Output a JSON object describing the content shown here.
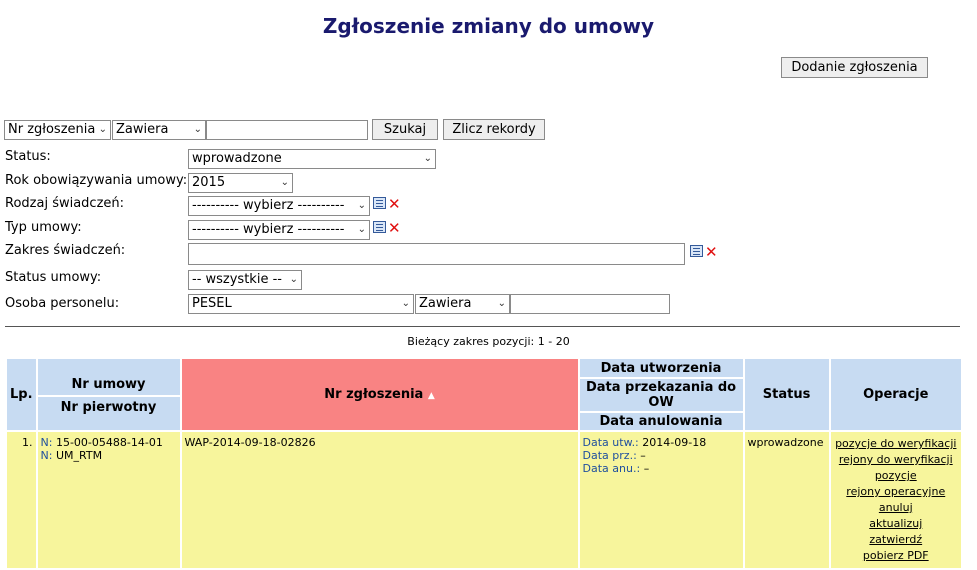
{
  "page_title": "Zgłoszenie zmiany do umowy",
  "add_button_label": "Dodanie zgłoszenia",
  "search": {
    "field_select": "Nr zgłoszenia",
    "operator_select": "Zawiera",
    "value": "",
    "search_button": "Szukaj",
    "count_button": "Zlicz rekordy"
  },
  "filters": {
    "status": {
      "label": "Status:",
      "value": "wprowadzone"
    },
    "year": {
      "label": "Rok obowiązywania umowy:",
      "value": "2015"
    },
    "benefit_kind": {
      "label": "Rodzaj świadczeń:",
      "value": "---------- wybierz ----------"
    },
    "contract_type": {
      "label": "Typ umowy:",
      "value": "---------- wybierz ----------"
    },
    "benefit_range": {
      "label": "Zakres świadczeń:",
      "value": ""
    },
    "contract_status": {
      "label": "Status umowy:",
      "value": "-- wszystkie --"
    },
    "staff": {
      "label": "Osoba personelu:",
      "field": "PESEL",
      "operator": "Zawiera",
      "value": ""
    }
  },
  "range_text": "Bieżący zakres pozycji: 1 - 20",
  "table": {
    "headers": {
      "lp": "Lp.",
      "nr_umowy": "Nr umowy",
      "nr_pierwotny": "Nr pierwotny",
      "nr_zgloszenia": "Nr zgłoszenia",
      "sort_indicator": "▲",
      "data_utw": "Data utworzenia",
      "data_prz": "Data przekazania do OW",
      "data_anu": "Data anulowania",
      "status": "Status",
      "operacje": "Operacje"
    },
    "rows": [
      {
        "lp": "1.",
        "nr_umowy": "N: 15-00-05488-14-01",
        "nr_pierwotny": "N: UM_RTM",
        "nr_zgloszenia": "WAP-2014-09-18-02826",
        "data_utw_label": "Data utw.:",
        "data_utw_value": "2014-09-18",
        "data_prz_label": "Data prz.:",
        "data_prz_value": "–",
        "data_anu_label": "Data anu.:",
        "data_anu_value": "–",
        "status": "wprowadzone",
        "operations": [
          "pozycje do weryfikacji",
          "rejony do weryfikacji",
          "pozycje",
          "rejony operacyjne",
          "anuluj",
          "aktualizuj",
          "zatwierdź",
          "pobierz PDF"
        ]
      }
    ]
  }
}
